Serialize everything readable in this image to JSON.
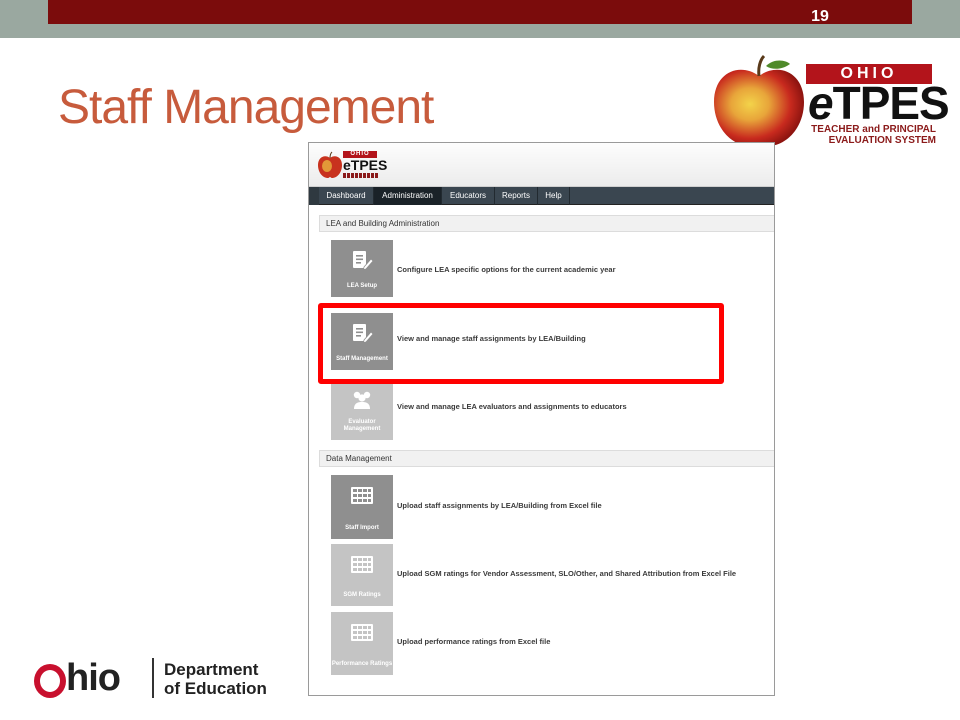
{
  "slide": {
    "number": "19",
    "title": "Staff Management",
    "colors": {
      "top_bar": "#7b0c0c",
      "title": "#c75b3c",
      "highlight": "#ff0000"
    }
  },
  "etpes_logo": {
    "ohio": "OHIO",
    "word_e": "e",
    "word_rest": "TPES",
    "line1": "TEACHER and PRINCIPAL",
    "line2": "EVALUATION SYSTEM",
    "icon": "apple-icon"
  },
  "ohio_logo": {
    "ohio_rest": "hio",
    "dept_line1": "Department",
    "dept_line2": "of Education"
  },
  "app": {
    "mini_logo": {
      "ohio": "OHIO",
      "tpes": "eTPES"
    },
    "nav": [
      "Dashboard",
      "Administration",
      "Educators",
      "Reports",
      "Help"
    ],
    "active_nav": "Administration",
    "sections": {
      "lea": "LEA and Building Administration",
      "data": "Data Management"
    },
    "tiles": [
      {
        "label": "LEA Setup",
        "desc": "Configure LEA specific options for the current academic year",
        "icon": "document-edit-icon",
        "dim": false
      },
      {
        "label": "Staff Management",
        "desc": "View and manage staff assignments by LEA/Building",
        "icon": "document-edit-icon",
        "dim": false
      },
      {
        "label": "Evaluator Management",
        "desc": "View and manage LEA evaluators and assignments to educators",
        "icon": "users-icon",
        "dim": true
      },
      {
        "label": "Staff Import",
        "desc": "Upload staff assignments by LEA/Building from Excel file",
        "icon": "table-grid-icon",
        "dim": false
      },
      {
        "label": "SGM Ratings",
        "desc": "Upload SGM ratings for Vendor Assessment, SLO/Other, and Shared Attribution from Excel File",
        "icon": "table-grid-icon",
        "dim": true
      },
      {
        "label": "Performance Ratings",
        "desc": "Upload performance ratings from Excel file",
        "icon": "table-grid-icon",
        "dim": true
      }
    ]
  }
}
